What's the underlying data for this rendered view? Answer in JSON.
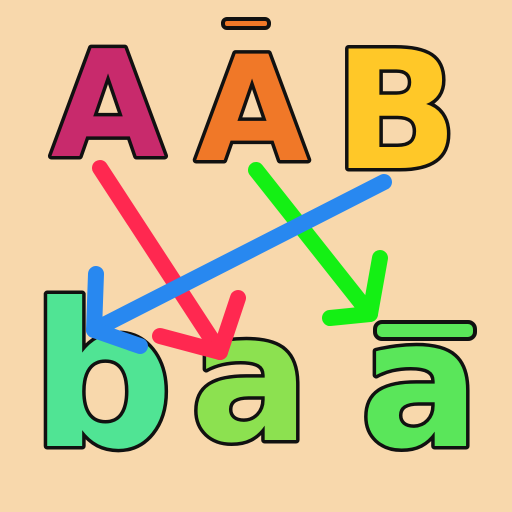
{
  "colors": {
    "background": "#f8d8ac",
    "outline": "#111111",
    "upper_a": "#c82a6c",
    "upper_a_macron": "#f07828",
    "upper_b": "#ffc828",
    "lower_b": "#50e494",
    "lower_a": "#8ce150",
    "lower_a_macron": "#5ae65a",
    "arrow_red": "#ff2850",
    "arrow_green": "#14f014",
    "arrow_blue": "#2888f0"
  },
  "top_row": {
    "upper_a": "A",
    "upper_a_macron": "A",
    "upper_b": "B"
  },
  "bottom_row": {
    "lower_b": "b",
    "lower_a": "a",
    "lower_a_macron": "a"
  },
  "arrows": [
    {
      "from": "upper_a",
      "to": "lower_a",
      "color": "arrow_red"
    },
    {
      "from": "upper_a_macron",
      "to": "lower_a_macron",
      "color": "arrow_green"
    },
    {
      "from": "upper_b",
      "to": "lower_b",
      "color": "arrow_blue"
    }
  ]
}
